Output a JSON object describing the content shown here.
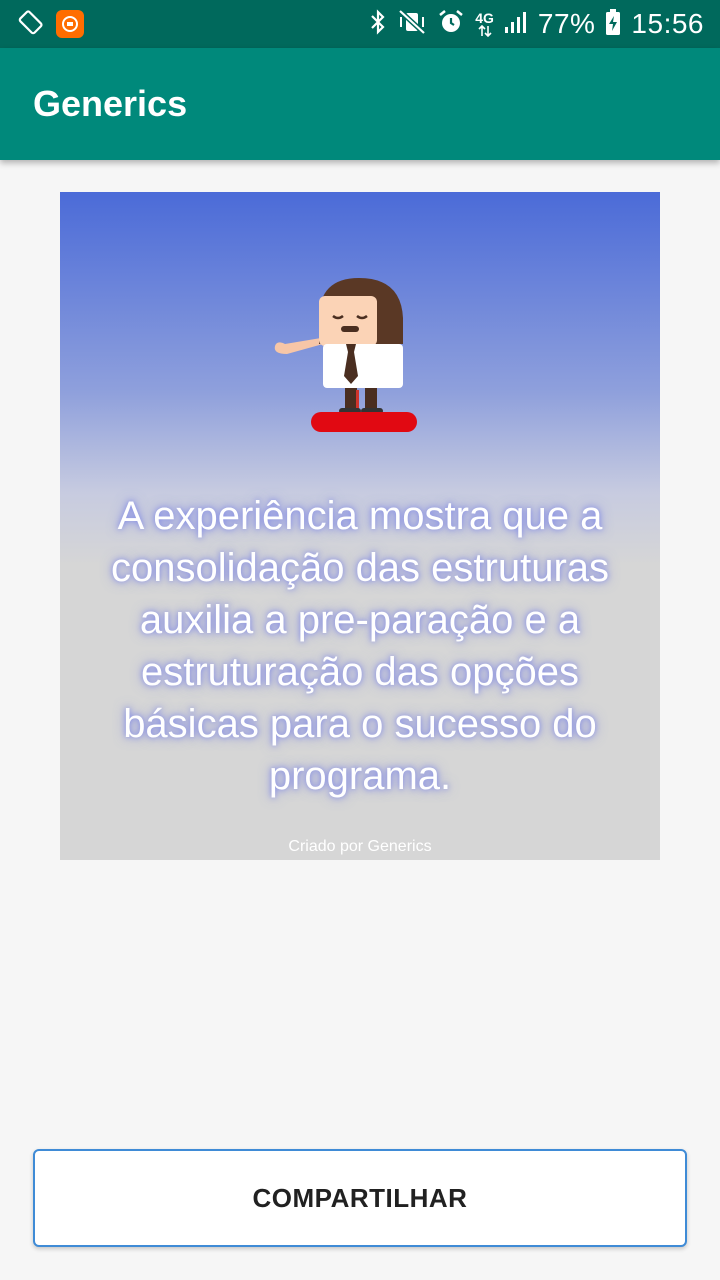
{
  "status_bar": {
    "battery": "77%",
    "time": "15:56",
    "network": "4G",
    "icons": [
      "screen-rotation-icon",
      "app-notification-icon",
      "bluetooth-icon",
      "vibrate-mute-icon",
      "alarm-icon",
      "data-arrows-icon",
      "signal-icon",
      "battery-charging-icon"
    ]
  },
  "app_bar": {
    "title": "Generics"
  },
  "card": {
    "quote": "A experiência mostra que a consolidação das estruturas auxilia a pre-paração e a estruturação das opções básicas para o sucesso do programa.",
    "credit": "Criado por Generics"
  },
  "share_button": {
    "label": "COMPARTILHAR"
  },
  "colors": {
    "status_bar": "#00695c",
    "app_bar": "#00897b",
    "card_gradient_top": "#4b6bd8",
    "card_gradient_bottom": "#d6d6d6",
    "button_border": "#3f8bd6"
  }
}
